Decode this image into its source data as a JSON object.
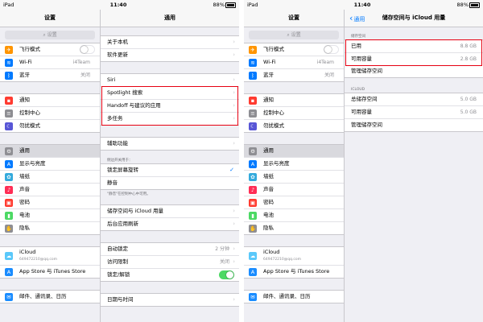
{
  "status": {
    "carrier": "iPad",
    "time": "11:40",
    "battery": "88%"
  },
  "colors": {
    "highlight": "#e60012",
    "accent": "#007aff",
    "toggle_on": "#4cd964"
  },
  "left": {
    "title": "设置",
    "search_placeholder": "设置",
    "group1": [
      {
        "label": "飞行模式",
        "icon": "airplane-icon",
        "glyph": "✈",
        "color": "#ff9500",
        "control": "toggle-off"
      },
      {
        "label": "Wi-Fi",
        "icon": "wifi-icon",
        "glyph": "≋",
        "color": "#007aff",
        "value": "i4Team"
      },
      {
        "label": "蓝牙",
        "icon": "bluetooth-icon",
        "glyph": "ᛒ",
        "color": "#007aff",
        "value": "关闭"
      }
    ],
    "group2": [
      {
        "label": "通知",
        "icon": "notifications-icon",
        "glyph": "▪",
        "color": "#ff3b30"
      },
      {
        "label": "控制中心",
        "icon": "control-center-icon",
        "glyph": "≡",
        "color": "#8e8e93"
      },
      {
        "label": "勿扰模式",
        "icon": "moon-icon",
        "glyph": "☾",
        "color": "#5856d6"
      }
    ],
    "group3": [
      {
        "label": "通用",
        "icon": "gear-icon",
        "glyph": "⚙",
        "color": "#8e8e93",
        "selected": true
      },
      {
        "label": "显示与亮度",
        "icon": "display-brightness-icon",
        "glyph": "A",
        "color": "#007aff"
      },
      {
        "label": "墙纸",
        "icon": "wallpaper-icon",
        "glyph": "✿",
        "color": "#34aadc"
      },
      {
        "label": "声音",
        "icon": "sound-icon",
        "glyph": "♪",
        "color": "#ff2d55"
      },
      {
        "label": "密码",
        "icon": "lock-icon",
        "glyph": "▣",
        "color": "#ff3b30"
      },
      {
        "label": "电池",
        "icon": "battery-icon",
        "glyph": "▮",
        "color": "#4cd964"
      },
      {
        "label": "隐私",
        "icon": "hand-icon",
        "glyph": "✋",
        "color": "#8e8e93"
      }
    ],
    "group4": [
      {
        "label": "iCloud",
        "sub": "649472210@qq.com",
        "icon": "cloud-icon",
        "glyph": "☁",
        "color": "#5ac8fa",
        "tall": true
      },
      {
        "label": "App Store 与 iTunes Store",
        "icon": "app-store-icon",
        "glyph": "A",
        "color": "#1a8cff"
      }
    ],
    "group5": [
      {
        "label": "邮件、通讯录、日历",
        "icon": "mail-icon",
        "glyph": "✉",
        "color": "#1a8cff"
      }
    ]
  },
  "screen1_right": {
    "title": "通用",
    "group1": [
      {
        "label": "关于本机"
      },
      {
        "label": "软件更新"
      }
    ],
    "group2": [
      {
        "label": "Siri"
      },
      {
        "label": "Spotlight 搜索"
      },
      {
        "label": "Handoff 与建议的应用"
      },
      {
        "label": "多任务"
      }
    ],
    "group3": [
      {
        "label": "辅助功能"
      }
    ],
    "side_switch_header": "侧边开关用于：",
    "group4": [
      {
        "label": "锁定屏幕旋转",
        "control": "check"
      },
      {
        "label": "静音"
      }
    ],
    "side_switch_footer": "\"静音\"在控制中心中可用。",
    "group5": [
      {
        "label": "储存空间与 iCloud 用量"
      },
      {
        "label": "后台应用刷新"
      }
    ],
    "group6": [
      {
        "label": "自动锁定",
        "value": "2 分钟"
      },
      {
        "label": "访问限制",
        "value": "关闭"
      },
      {
        "label": "锁定/解锁",
        "control": "toggle-on"
      }
    ],
    "group7": [
      {
        "label": "日期与时间"
      }
    ]
  },
  "screen2_right": {
    "back": "通用",
    "title": "储存空间与 iCloud 用量",
    "storage_header": "储存空间",
    "storage": [
      {
        "label": "已用",
        "value": "8.8 GB"
      },
      {
        "label": "可用容量",
        "value": "2.8 GB"
      }
    ],
    "storage_manage": "管理储存空间",
    "icloud_header": "ICLOUD",
    "icloud": [
      {
        "label": "总储存空间",
        "value": "5.0 GB"
      },
      {
        "label": "可用容量",
        "value": "5.0 GB"
      },
      {
        "label": "管理储存空间"
      }
    ]
  }
}
